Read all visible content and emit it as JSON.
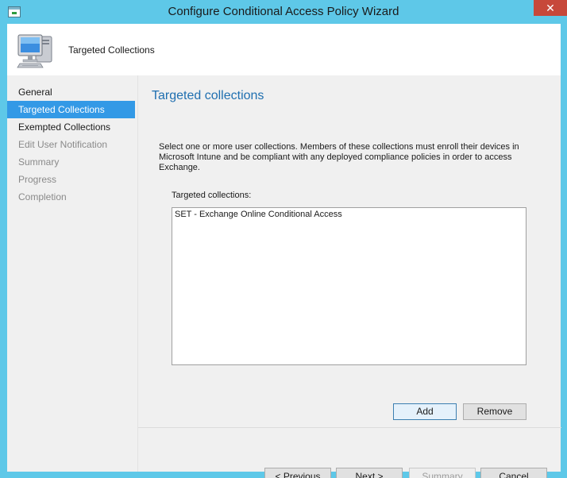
{
  "window": {
    "title": "Configure Conditional Access Policy Wizard",
    "close_label": "✕"
  },
  "header": {
    "title": "Targeted Collections",
    "icon": "computer-icon"
  },
  "nav": {
    "items": [
      {
        "label": "General",
        "state": "normal"
      },
      {
        "label": "Targeted Collections",
        "state": "active"
      },
      {
        "label": "Exempted Collections",
        "state": "normal"
      },
      {
        "label": "Edit User Notification",
        "state": "disabled"
      },
      {
        "label": "Summary",
        "state": "disabled"
      },
      {
        "label": "Progress",
        "state": "disabled"
      },
      {
        "label": "Completion",
        "state": "disabled"
      }
    ]
  },
  "main": {
    "title": "Targeted collections",
    "description": "Select one or more user collections. Members of these collections must enroll their devices in Microsoft Intune and be compliant with any deployed compliance policies in order to access Exchange.",
    "list_label": "Targeted collections:",
    "list_items": [
      "SET - Exchange Online Conditional Access"
    ],
    "add_label": "Add",
    "remove_label": "Remove"
  },
  "footer": {
    "previous_label": "< Previous",
    "next_label": "Next >",
    "summary_label": "Summary",
    "cancel_label": "Cancel"
  },
  "colors": {
    "frame": "#5ec8e8",
    "accent": "#3399e6",
    "title_blue": "#1f6fb0",
    "close_red": "#c7483a"
  }
}
